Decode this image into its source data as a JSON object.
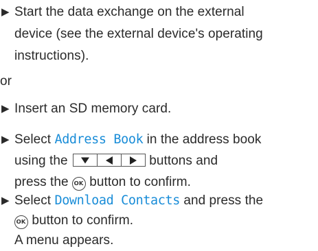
{
  "bullet_symbol": "▶",
  "step1": {
    "line1": "Start the data exchange on the external",
    "line2": "device (see the external device's operating",
    "line3": "instructions)."
  },
  "or_label": "or",
  "step2": {
    "line1": "Insert an SD memory card."
  },
  "step3": {
    "select": "Select",
    "term": "Address Book",
    "line1_rest": "in the address book",
    "using": "using the",
    "buttons_label": "buttons and",
    "press": "press the",
    "confirm": "button to confirm.",
    "keys": [
      "down-arrow",
      "left-arrow",
      "right-arrow"
    ]
  },
  "step4": {
    "select": "Select",
    "term": "Download Contacts",
    "line1_rest": "and press the",
    "confirm": "button to confirm.",
    "result": "A menu appears."
  },
  "ok_button": {
    "label": "OK",
    "icon": "ok-button-icon"
  },
  "colors": {
    "text": "#2a2a2a",
    "term_blue": "#1a8dd8"
  }
}
